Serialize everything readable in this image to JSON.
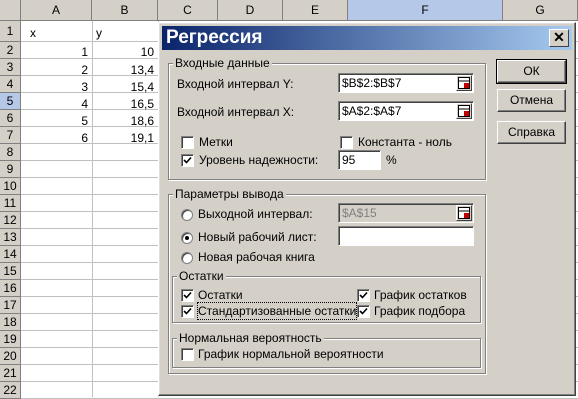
{
  "sheet": {
    "columns": [
      "A",
      "B",
      "C",
      "D",
      "E",
      "F",
      "G"
    ],
    "selected_column": "F",
    "rows": [
      "1",
      "2",
      "3",
      "4",
      "5",
      "6",
      "7",
      "8",
      "9",
      "10",
      "11",
      "12",
      "13",
      "14",
      "15",
      "16",
      "17",
      "18",
      "19",
      "20",
      "21",
      "22"
    ],
    "selected_row": "5",
    "cells": {
      "A1": "x",
      "B1": "y",
      "A2": "1",
      "B2": "10",
      "A3": "2",
      "B3": "13,4",
      "A4": "3",
      "B4": "15,4",
      "A5": "4",
      "B5": "16,5",
      "A6": "5",
      "B6": "18,6",
      "A7": "6",
      "B7": "19,1"
    }
  },
  "dialog": {
    "title": "Регрессия",
    "close_glyph": "✕",
    "buttons": {
      "ok": "ОК",
      "cancel": "Отмена",
      "help": "Справка"
    },
    "input_group": {
      "label": "Входные данные",
      "y_range_label": "Входной интервал Y:",
      "y_range_value": "$B$2:$B$7",
      "x_range_label": "Входной интервал X:",
      "x_range_value": "$A$2:$A$7",
      "labels_label": "Метки",
      "labels_checked": false,
      "const_zero_label": "Константа - ноль",
      "const_zero_checked": false,
      "confidence_label": "Уровень надежности:",
      "confidence_checked": true,
      "confidence_value": "95",
      "percent_sign": "%"
    },
    "output_group": {
      "label": "Параметры вывода",
      "output_range_label": "Выходной интервал:",
      "output_range_value": "$A$15",
      "new_sheet_label": "Новый рабочий лист:",
      "new_sheet_value": "",
      "new_workbook_label": "Новая рабочая книга",
      "selected_option": "new_sheet"
    },
    "residuals_group": {
      "label": "Остатки",
      "residuals_label": "Остатки",
      "residuals_checked": true,
      "std_residuals_label": "Стандартизованные остатки",
      "std_residuals_checked": true,
      "residual_plots_label": "График остатков",
      "residual_plots_checked": true,
      "line_fit_label": "График подбора",
      "line_fit_checked": true
    },
    "normal_group": {
      "label": "Нормальная вероятность",
      "normal_plot_label": "График нормальной вероятности",
      "normal_plot_checked": false
    }
  }
}
